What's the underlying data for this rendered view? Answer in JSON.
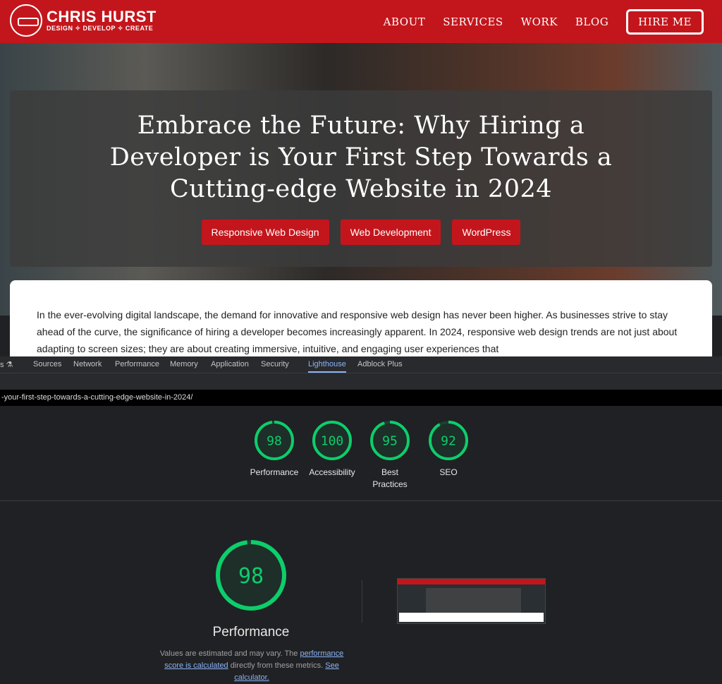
{
  "site": {
    "logo_name": "CHRIS HURST",
    "logo_tagline": "DESIGN ✧ DEVELOP ✧ CREATE",
    "brand_color": "#c3161c",
    "nav": [
      "ABOUT",
      "SERVICES",
      "WORK",
      "BLOG"
    ],
    "hire": "HIRE ME"
  },
  "hero": {
    "title_lines": [
      "Embrace the Future: Why Hiring a",
      "Developer is Your First Step Towards a",
      "Cutting-edge Website in 2024"
    ],
    "tags": [
      "Responsive Web Design",
      "Web Development",
      "WordPress"
    ]
  },
  "article": {
    "text": "In the ever-evolving digital landscape, the demand for innovative and responsive web design has never been higher. As businesses strive to stay ahead of the curve, the significance of hiring a developer becomes increasingly apparent. In 2024, responsive web design trends are not just about adapting to screen sizes; they are about creating immersive, intuitive, and engaging user experiences that"
  },
  "devtools": {
    "tabs": [
      "s ⚗",
      "Sources",
      "Network",
      "Performance",
      "Memory",
      "Application",
      "Security",
      "Lighthouse",
      "Adblock Plus"
    ],
    "active_tab": "Lighthouse",
    "url": "-your-first-step-towards-a-cutting-edge-website-in-2024/",
    "score_color": "#0cce6b",
    "scores": [
      {
        "label": "Performance",
        "value": 98
      },
      {
        "label": "Accessibility",
        "value": 100
      },
      {
        "label": "Best Practices",
        "value": 95
      },
      {
        "label": "SEO",
        "value": 92
      }
    ],
    "main": {
      "value": 98,
      "label": "Performance"
    },
    "note": {
      "pre": "Values are estimated and may vary. The ",
      "link1": "performance score is calculated",
      "mid": " directly from these metrics. ",
      "link2": "See calculator."
    }
  }
}
